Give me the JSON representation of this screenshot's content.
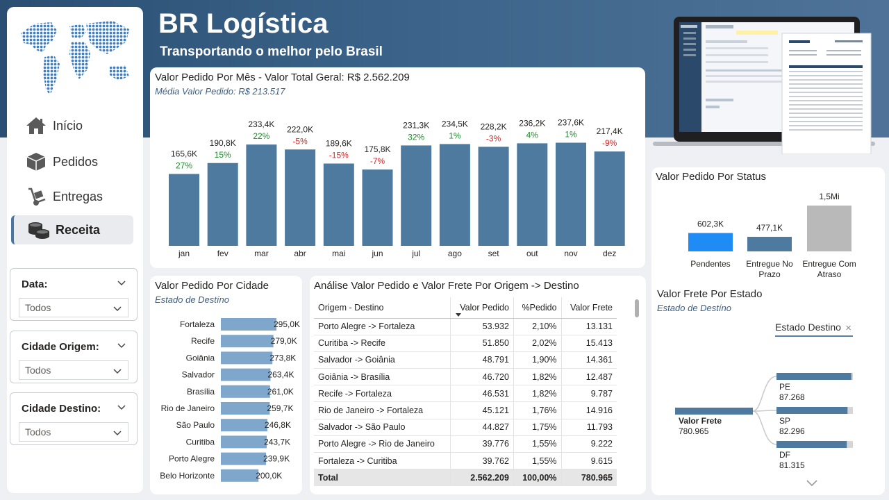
{
  "header": {
    "title": "BR Logística",
    "subtitle": "Transportando o melhor pelo Brasil"
  },
  "nav": [
    {
      "label": "Início",
      "icon": "home-icon",
      "active": false
    },
    {
      "label": "Pedidos",
      "icon": "box-icon",
      "active": false
    },
    {
      "label": "Entregas",
      "icon": "hand-truck-icon",
      "active": false
    },
    {
      "label": "Receita",
      "icon": "coins-icon",
      "active": true
    }
  ],
  "filters": [
    {
      "label": "Data:",
      "value": "Todos"
    },
    {
      "label": "Cidade Origem:",
      "value": "Todos"
    },
    {
      "label": "Cidade Destino:",
      "value": "Todos"
    }
  ],
  "monthly": {
    "title": "Valor Pedido Por Mês - Valor Total Geral: R$ 2.562.209",
    "subtitle": "Média Valor Pedido: R$ 213.517"
  },
  "by_city": {
    "title": "Valor Pedido Por Cidade",
    "subtitle": "Estado de Destíno"
  },
  "table": {
    "title": "Análise Valor Pedido e Valor Frete Por Origem -> Destino",
    "headers": [
      "Origem - Destino",
      "Valor Pedido",
      "%Pedido",
      "Valor Frete"
    ],
    "rows": [
      [
        "Porto Alegre -> Fortaleza",
        "53.932",
        "2,10%",
        "13.131"
      ],
      [
        "Curitiba -> Recife",
        "51.850",
        "2,02%",
        "15.413"
      ],
      [
        "Salvador -> Goiânia",
        "48.791",
        "1,90%",
        "14.361"
      ],
      [
        "Goiânia -> Brasília",
        "46.720",
        "1,82%",
        "12.487"
      ],
      [
        "Recife -> Fortaleza",
        "46.531",
        "1,82%",
        "9.787"
      ],
      [
        "Rio de Janeiro -> Fortaleza",
        "45.121",
        "1,76%",
        "14.916"
      ],
      [
        "Salvador -> São Paulo",
        "44.827",
        "1,75%",
        "11.793"
      ],
      [
        "Porto Alegre -> Rio de Janeiro",
        "39.776",
        "1,55%",
        "9.222"
      ],
      [
        "Fortaleza -> Curitiba",
        "39.762",
        "1,55%",
        "9.615"
      ]
    ],
    "total": [
      "Total",
      "2.562.209",
      "100,00%",
      "780.965"
    ]
  },
  "status": {
    "title": "Valor Pedido Por Status"
  },
  "freight": {
    "title": "Valor Frete Por Estado",
    "subtitle": "Estado de Destíno",
    "filter_label": "Estado Destino",
    "root_label": "Valor Frete",
    "root_value": "780.965",
    "nodes": [
      {
        "label": "PE",
        "value": "87.268",
        "fraction": 0.98
      },
      {
        "label": "SP",
        "value": "82.296",
        "fraction": 0.93
      },
      {
        "label": "DF",
        "value": "81.315",
        "fraction": 0.92
      }
    ]
  },
  "chart_data": [
    {
      "type": "bar",
      "title": "Valor Pedido Por Mês - Valor Total Geral: R$ 2.562.209",
      "categories": [
        "jan",
        "fev",
        "mar",
        "abr",
        "mai",
        "jun",
        "jul",
        "ago",
        "set",
        "out",
        "nov",
        "dez"
      ],
      "values": [
        165600,
        190800,
        233400,
        222000,
        189600,
        175800,
        231300,
        234500,
        228200,
        236200,
        237600,
        217400
      ],
      "data_labels": [
        "165,6K",
        "190,8K",
        "233,4K",
        "222,0K",
        "189,6K",
        "175,8K",
        "231,3K",
        "234,5K",
        "228,2K",
        "236,2K",
        "237,6K",
        "217,4K"
      ],
      "change_labels": [
        "27%",
        "15%",
        "22%",
        "-5%",
        "-15%",
        "-7%",
        "32%",
        "1%",
        "-3%",
        "4%",
        "1%",
        "-9%"
      ],
      "colors": {
        "bar": "#4f7aa0",
        "positive": "#1e8c2c",
        "negative": "#d02b2b"
      }
    },
    {
      "type": "bar",
      "orientation": "horizontal",
      "title": "Valor Pedido Por Cidade",
      "categories": [
        "Fortaleza",
        "Recife",
        "Goiânia",
        "Salvador",
        "Brasília",
        "Rio de Janeiro",
        "São Paulo",
        "Curitiba",
        "Porto Alegre",
        "Belo Horizonte"
      ],
      "values": [
        295000,
        279000,
        273800,
        263400,
        261000,
        259700,
        246800,
        243700,
        239900,
        200000
      ],
      "data_labels": [
        "295,0K",
        "279,0K",
        "273,8K",
        "263,4K",
        "261,0K",
        "259,7K",
        "246,8K",
        "243,7K",
        "239,9K",
        "200,0K"
      ],
      "colors": {
        "bar": "#7ea7cb"
      }
    },
    {
      "type": "bar",
      "title": "Valor Pedido Por Status",
      "categories": [
        "Pendentes",
        "Entregue No Prazo",
        "Entregue Com Atraso"
      ],
      "values": [
        602300,
        477100,
        1500000
      ],
      "data_labels": [
        "602,3K",
        "477,1K",
        "1,5Mi"
      ],
      "colors": {
        "bars": [
          "#1f8cf5",
          "#4f7aa0",
          "#b9b9b9"
        ]
      }
    }
  ]
}
